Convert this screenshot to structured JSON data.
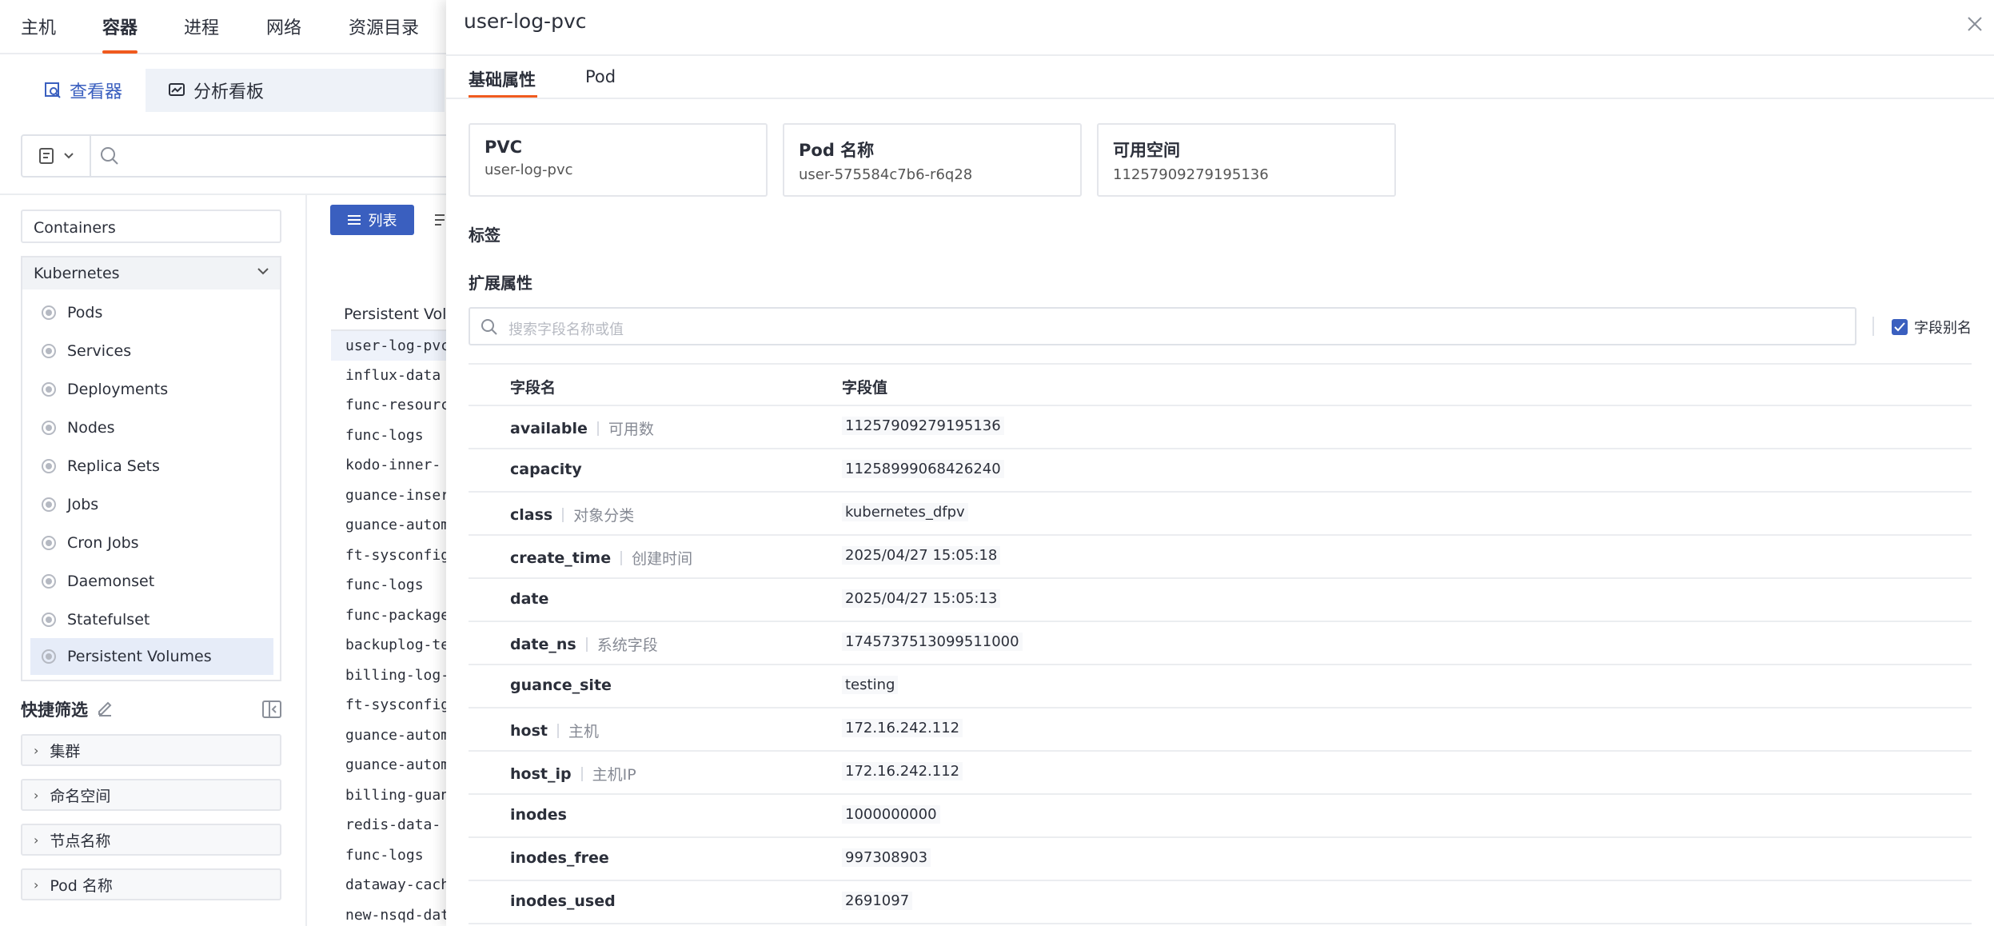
{
  "topnav": {
    "tabs": [
      {
        "label": "主机"
      },
      {
        "label": "容器"
      },
      {
        "label": "进程"
      },
      {
        "label": "网络"
      },
      {
        "label": "资源目录"
      }
    ]
  },
  "subtabs": {
    "viewer": "查看器",
    "dashboard": "分析看板"
  },
  "sidebar": {
    "containers": "Containers",
    "kubernetes": "Kubernetes",
    "items": [
      "Pods",
      "Services",
      "Deployments",
      "Nodes",
      "Replica Sets",
      "Jobs",
      "Cron Jobs",
      "Daemonset",
      "Statefulset",
      "Persistent Volumes"
    ],
    "quick_filter_title": "快捷筛选",
    "filters": [
      "集群",
      "命名空间",
      "节点名称",
      "Pod 名称"
    ]
  },
  "list": {
    "list_button": "列表",
    "column_header": "Persistent Volumes",
    "rows": [
      "user-log-pvc",
      "influx-data",
      "func-resources",
      "func-logs",
      "kodo-inner-",
      "guance-insert",
      "guance-autom",
      "ft-sysconfig",
      "func-logs",
      "func-package",
      "backuplog-te",
      "billing-log-",
      "ft-sysconfig",
      "guance-autom",
      "guance-autom",
      "billing-guan",
      "redis-data-",
      "func-logs",
      "dataway-cach",
      "new-nsqd-dat"
    ]
  },
  "drawer": {
    "title": "user-log-pvc",
    "tabs": [
      "基础属性",
      "Pod"
    ],
    "cards": [
      {
        "title": "PVC",
        "value": "user-log-pvc"
      },
      {
        "title": "Pod 名称",
        "value": "user-575584c7b6-r6q28"
      },
      {
        "title": "可用空间",
        "value": "11257909279195136"
      }
    ],
    "labels_section": "标签",
    "ext_section": "扩展属性",
    "search_placeholder": "搜索字段名称或值",
    "alias_toggle": "字段别名",
    "table_headers": {
      "field": "字段名",
      "value": "字段值"
    },
    "fields": [
      {
        "name": "available",
        "alias": "可用数",
        "value": "11257909279195136"
      },
      {
        "name": "capacity",
        "alias": "",
        "value": "11258999068426240"
      },
      {
        "name": "class",
        "alias": "对象分类",
        "value": "kubernetes_dfpv"
      },
      {
        "name": "create_time",
        "alias": "创建时间",
        "value": "2025/04/27 15:05:18"
      },
      {
        "name": "date",
        "alias": "",
        "value": "2025/04/27 15:05:13"
      },
      {
        "name": "date_ns",
        "alias": "系统字段",
        "value": "1745737513099511000"
      },
      {
        "name": "guance_site",
        "alias": "",
        "value": "testing"
      },
      {
        "name": "host",
        "alias": "主机",
        "value": "172.16.242.112"
      },
      {
        "name": "host_ip",
        "alias": "主机IP",
        "value": "172.16.242.112"
      },
      {
        "name": "inodes",
        "alias": "",
        "value": "1000000000"
      },
      {
        "name": "inodes_free",
        "alias": "",
        "value": "997308903"
      },
      {
        "name": "inodes_used",
        "alias": "",
        "value": "2691097"
      }
    ]
  },
  "colors": {
    "accent": "#3a5fbf",
    "active_underline": "#f05a1e"
  }
}
